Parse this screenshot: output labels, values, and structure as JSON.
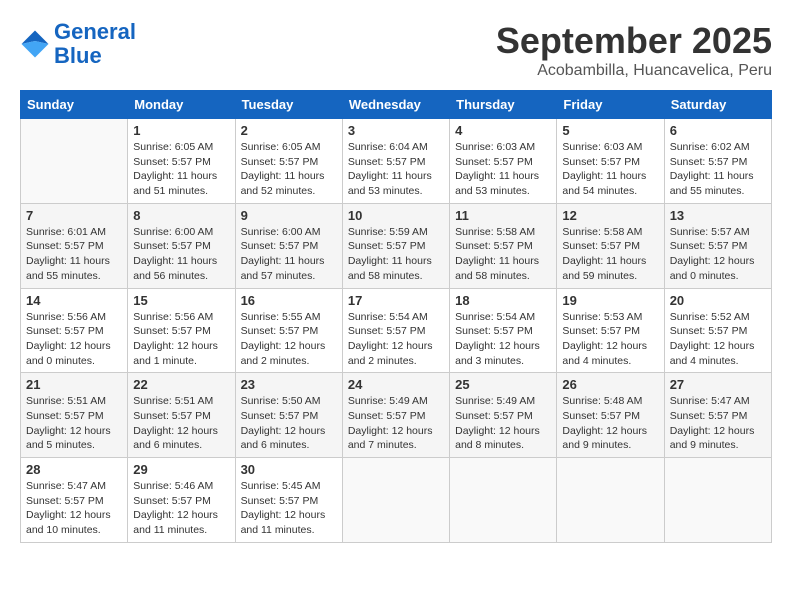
{
  "header": {
    "logo_line1": "General",
    "logo_line2": "Blue",
    "month": "September 2025",
    "location": "Acobambilla, Huancavelica, Peru"
  },
  "days_of_week": [
    "Sunday",
    "Monday",
    "Tuesday",
    "Wednesday",
    "Thursday",
    "Friday",
    "Saturday"
  ],
  "weeks": [
    [
      {
        "day": "",
        "info": ""
      },
      {
        "day": "1",
        "info": "Sunrise: 6:05 AM\nSunset: 5:57 PM\nDaylight: 11 hours\nand 51 minutes."
      },
      {
        "day": "2",
        "info": "Sunrise: 6:05 AM\nSunset: 5:57 PM\nDaylight: 11 hours\nand 52 minutes."
      },
      {
        "day": "3",
        "info": "Sunrise: 6:04 AM\nSunset: 5:57 PM\nDaylight: 11 hours\nand 53 minutes."
      },
      {
        "day": "4",
        "info": "Sunrise: 6:03 AM\nSunset: 5:57 PM\nDaylight: 11 hours\nand 53 minutes."
      },
      {
        "day": "5",
        "info": "Sunrise: 6:03 AM\nSunset: 5:57 PM\nDaylight: 11 hours\nand 54 minutes."
      },
      {
        "day": "6",
        "info": "Sunrise: 6:02 AM\nSunset: 5:57 PM\nDaylight: 11 hours\nand 55 minutes."
      }
    ],
    [
      {
        "day": "7",
        "info": "Sunrise: 6:01 AM\nSunset: 5:57 PM\nDaylight: 11 hours\nand 55 minutes."
      },
      {
        "day": "8",
        "info": "Sunrise: 6:00 AM\nSunset: 5:57 PM\nDaylight: 11 hours\nand 56 minutes."
      },
      {
        "day": "9",
        "info": "Sunrise: 6:00 AM\nSunset: 5:57 PM\nDaylight: 11 hours\nand 57 minutes."
      },
      {
        "day": "10",
        "info": "Sunrise: 5:59 AM\nSunset: 5:57 PM\nDaylight: 11 hours\nand 58 minutes."
      },
      {
        "day": "11",
        "info": "Sunrise: 5:58 AM\nSunset: 5:57 PM\nDaylight: 11 hours\nand 58 minutes."
      },
      {
        "day": "12",
        "info": "Sunrise: 5:58 AM\nSunset: 5:57 PM\nDaylight: 11 hours\nand 59 minutes."
      },
      {
        "day": "13",
        "info": "Sunrise: 5:57 AM\nSunset: 5:57 PM\nDaylight: 12 hours\nand 0 minutes."
      }
    ],
    [
      {
        "day": "14",
        "info": "Sunrise: 5:56 AM\nSunset: 5:57 PM\nDaylight: 12 hours\nand 0 minutes."
      },
      {
        "day": "15",
        "info": "Sunrise: 5:56 AM\nSunset: 5:57 PM\nDaylight: 12 hours\nand 1 minute."
      },
      {
        "day": "16",
        "info": "Sunrise: 5:55 AM\nSunset: 5:57 PM\nDaylight: 12 hours\nand 2 minutes."
      },
      {
        "day": "17",
        "info": "Sunrise: 5:54 AM\nSunset: 5:57 PM\nDaylight: 12 hours\nand 2 minutes."
      },
      {
        "day": "18",
        "info": "Sunrise: 5:54 AM\nSunset: 5:57 PM\nDaylight: 12 hours\nand 3 minutes."
      },
      {
        "day": "19",
        "info": "Sunrise: 5:53 AM\nSunset: 5:57 PM\nDaylight: 12 hours\nand 4 minutes."
      },
      {
        "day": "20",
        "info": "Sunrise: 5:52 AM\nSunset: 5:57 PM\nDaylight: 12 hours\nand 4 minutes."
      }
    ],
    [
      {
        "day": "21",
        "info": "Sunrise: 5:51 AM\nSunset: 5:57 PM\nDaylight: 12 hours\nand 5 minutes."
      },
      {
        "day": "22",
        "info": "Sunrise: 5:51 AM\nSunset: 5:57 PM\nDaylight: 12 hours\nand 6 minutes."
      },
      {
        "day": "23",
        "info": "Sunrise: 5:50 AM\nSunset: 5:57 PM\nDaylight: 12 hours\nand 6 minutes."
      },
      {
        "day": "24",
        "info": "Sunrise: 5:49 AM\nSunset: 5:57 PM\nDaylight: 12 hours\nand 7 minutes."
      },
      {
        "day": "25",
        "info": "Sunrise: 5:49 AM\nSunset: 5:57 PM\nDaylight: 12 hours\nand 8 minutes."
      },
      {
        "day": "26",
        "info": "Sunrise: 5:48 AM\nSunset: 5:57 PM\nDaylight: 12 hours\nand 9 minutes."
      },
      {
        "day": "27",
        "info": "Sunrise: 5:47 AM\nSunset: 5:57 PM\nDaylight: 12 hours\nand 9 minutes."
      }
    ],
    [
      {
        "day": "28",
        "info": "Sunrise: 5:47 AM\nSunset: 5:57 PM\nDaylight: 12 hours\nand 10 minutes."
      },
      {
        "day": "29",
        "info": "Sunrise: 5:46 AM\nSunset: 5:57 PM\nDaylight: 12 hours\nand 11 minutes."
      },
      {
        "day": "30",
        "info": "Sunrise: 5:45 AM\nSunset: 5:57 PM\nDaylight: 12 hours\nand 11 minutes."
      },
      {
        "day": "",
        "info": ""
      },
      {
        "day": "",
        "info": ""
      },
      {
        "day": "",
        "info": ""
      },
      {
        "day": "",
        "info": ""
      }
    ]
  ]
}
